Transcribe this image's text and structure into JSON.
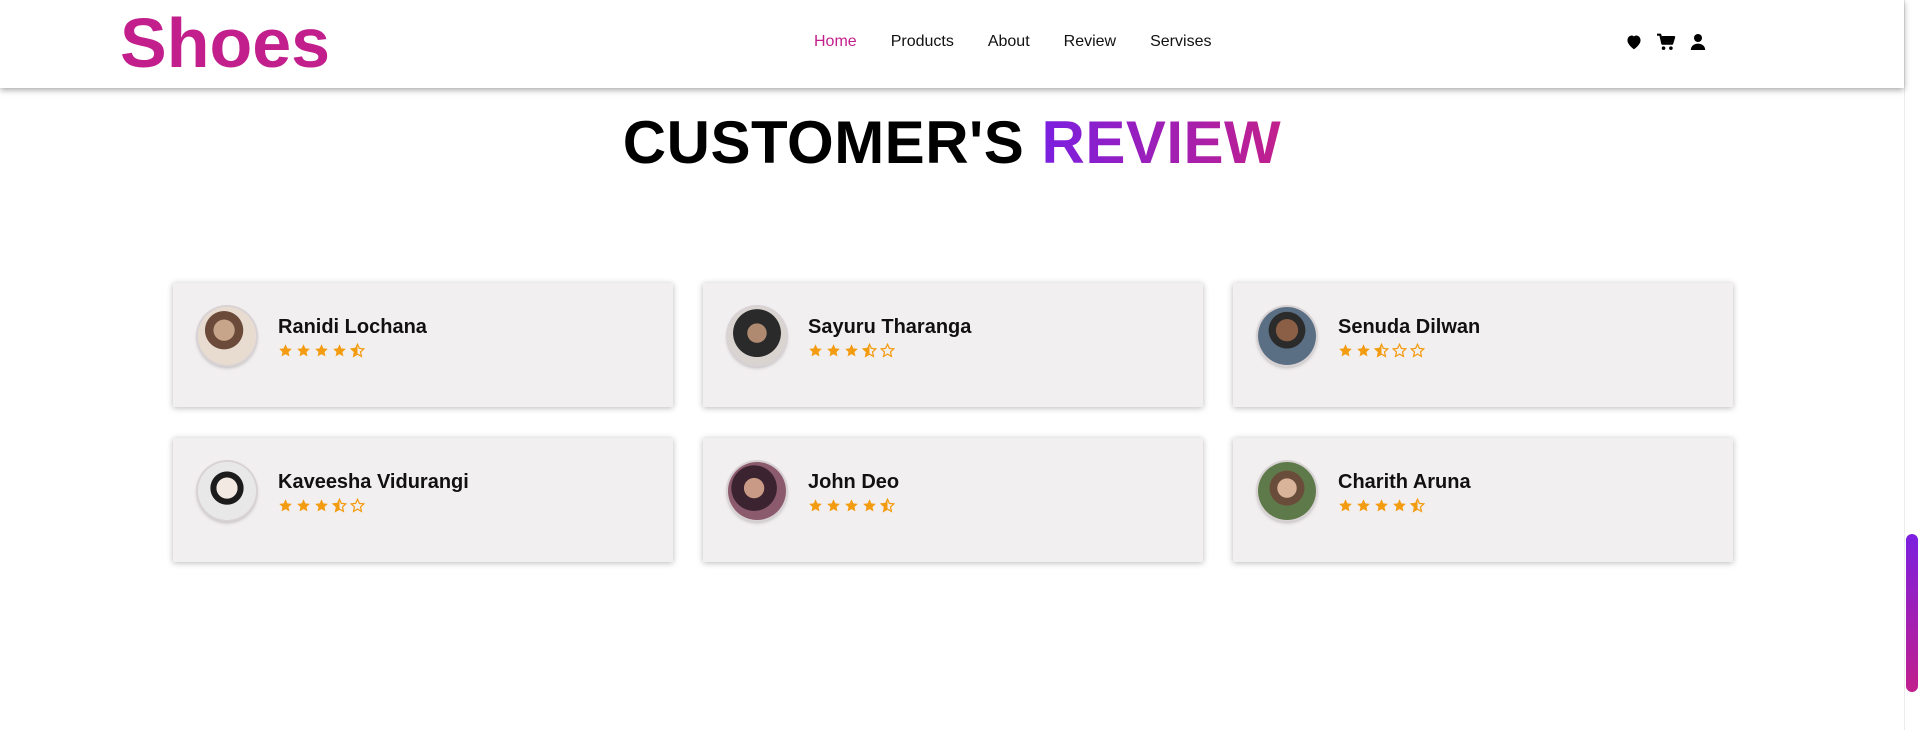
{
  "brand": {
    "logo": "Shoes",
    "color": "#c21f8c"
  },
  "nav": {
    "items": [
      {
        "label": "Home",
        "active": true
      },
      {
        "label": "Products",
        "active": false
      },
      {
        "label": "About",
        "active": false
      },
      {
        "label": "Review",
        "active": false
      },
      {
        "label": "Servises",
        "active": false
      }
    ]
  },
  "header_icons": [
    "heart-icon",
    "cart-icon",
    "user-icon"
  ],
  "section": {
    "title_main": "CUSTOMER'S",
    "title_accent": "REVIEW",
    "accent_gradient": [
      "#7b1fe0",
      "#c21f8c"
    ]
  },
  "reviews": [
    {
      "name": "Ranidi Lochana",
      "rating": 4.5,
      "avatar": "woman-avatar"
    },
    {
      "name": "Sayuru Tharanga",
      "rating": 3.5,
      "avatar": "man-avatar"
    },
    {
      "name": "Senuda Dilwan",
      "rating": 2.5,
      "avatar": "man-glasses-avatar"
    },
    {
      "name": "Kaveesha Vidurangi",
      "rating": 3.5,
      "avatar": "woman-panda-hood-avatar"
    },
    {
      "name": "John Deo",
      "rating": 4.5,
      "avatar": "woman-avatar"
    },
    {
      "name": "Charith Aruna",
      "rating": 4.5,
      "avatar": "man-avatar"
    }
  ],
  "star_color": "#f39c12"
}
